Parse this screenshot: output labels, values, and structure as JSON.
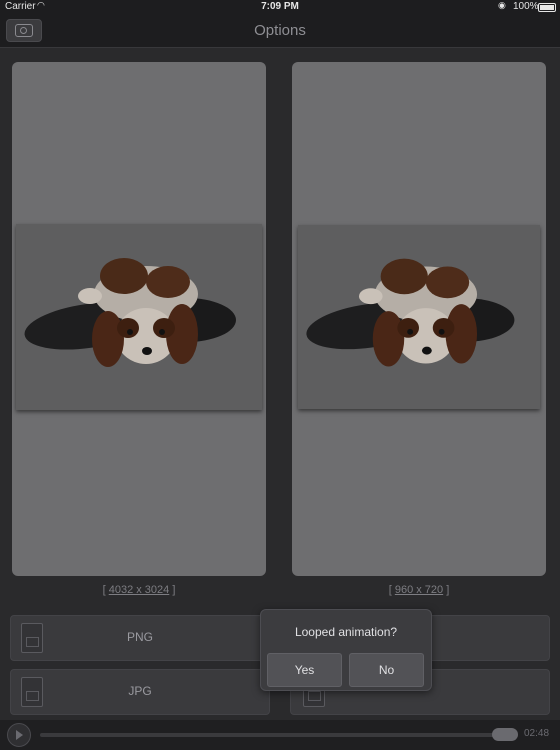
{
  "status_bar": {
    "carrier": "Carrier",
    "time": "7:09 PM",
    "battery": "100%"
  },
  "nav": {
    "title": "Options",
    "back_icon": "camera-icon"
  },
  "previews": [
    {
      "size_label": "4032 x 3024"
    },
    {
      "size_label": "960 x 720"
    }
  ],
  "formats": {
    "png": "PNG",
    "jpg": "JPG"
  },
  "dialog": {
    "title": "Looped animation?",
    "yes": "Yes",
    "no": "No"
  },
  "player": {
    "time": "02:48"
  },
  "colors": {
    "background": "#2a2a2c",
    "card": "#6e6e70",
    "dialog": "#3c3c3f"
  }
}
